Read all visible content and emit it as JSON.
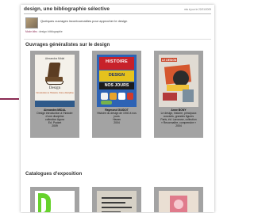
{
  "header": {
    "title": "design, une bibliographie sélective",
    "updated": "mis à jour le 22/01/2009"
  },
  "intro": {
    "text": "Quelques ouvrages incontournables pour approcher le design",
    "breadcrumb_home": "Mode.bibs",
    "breadcrumb_sep": " : ",
    "breadcrumb_current": "design: bibliographie"
  },
  "sections": {
    "general_title": "Ouvrages généralistes sur le design",
    "catalogues_title": "Catalogues d'exposition"
  },
  "books": [
    {
      "cover_line1": "Alexandra Midal",
      "cover_title": "Design",
      "cover_sub": "Introduction à l'histoire d'une discipline",
      "author": "Alexandra MIDAL",
      "lines": [
        "Design introduction à l'histoire",
        "d'une discipline",
        "collection Agora",
        "Ed. Pocket",
        "2009"
      ]
    },
    {
      "cover_red": "HISTOIRE",
      "cover_yellow": "DESIGN",
      "cover_black": "NOS JOURS",
      "author": "Raymond GUIDOT",
      "lines": [
        "Histoire du design de 1940 à nos",
        "jours",
        "Hazan",
        "2004"
      ]
    },
    {
      "cover_tag": "LE DESIGN",
      "author": "Anne BONY",
      "lines": [
        "Le design, histoire, principaux",
        "courants, grandes figures",
        "Paris, éd. Larousse, collection",
        "« Reconnaître, comprendre »",
        "2004"
      ]
    }
  ],
  "colors": {
    "accent": "#8a2a52",
    "card_bg": "#a3a3a3"
  }
}
